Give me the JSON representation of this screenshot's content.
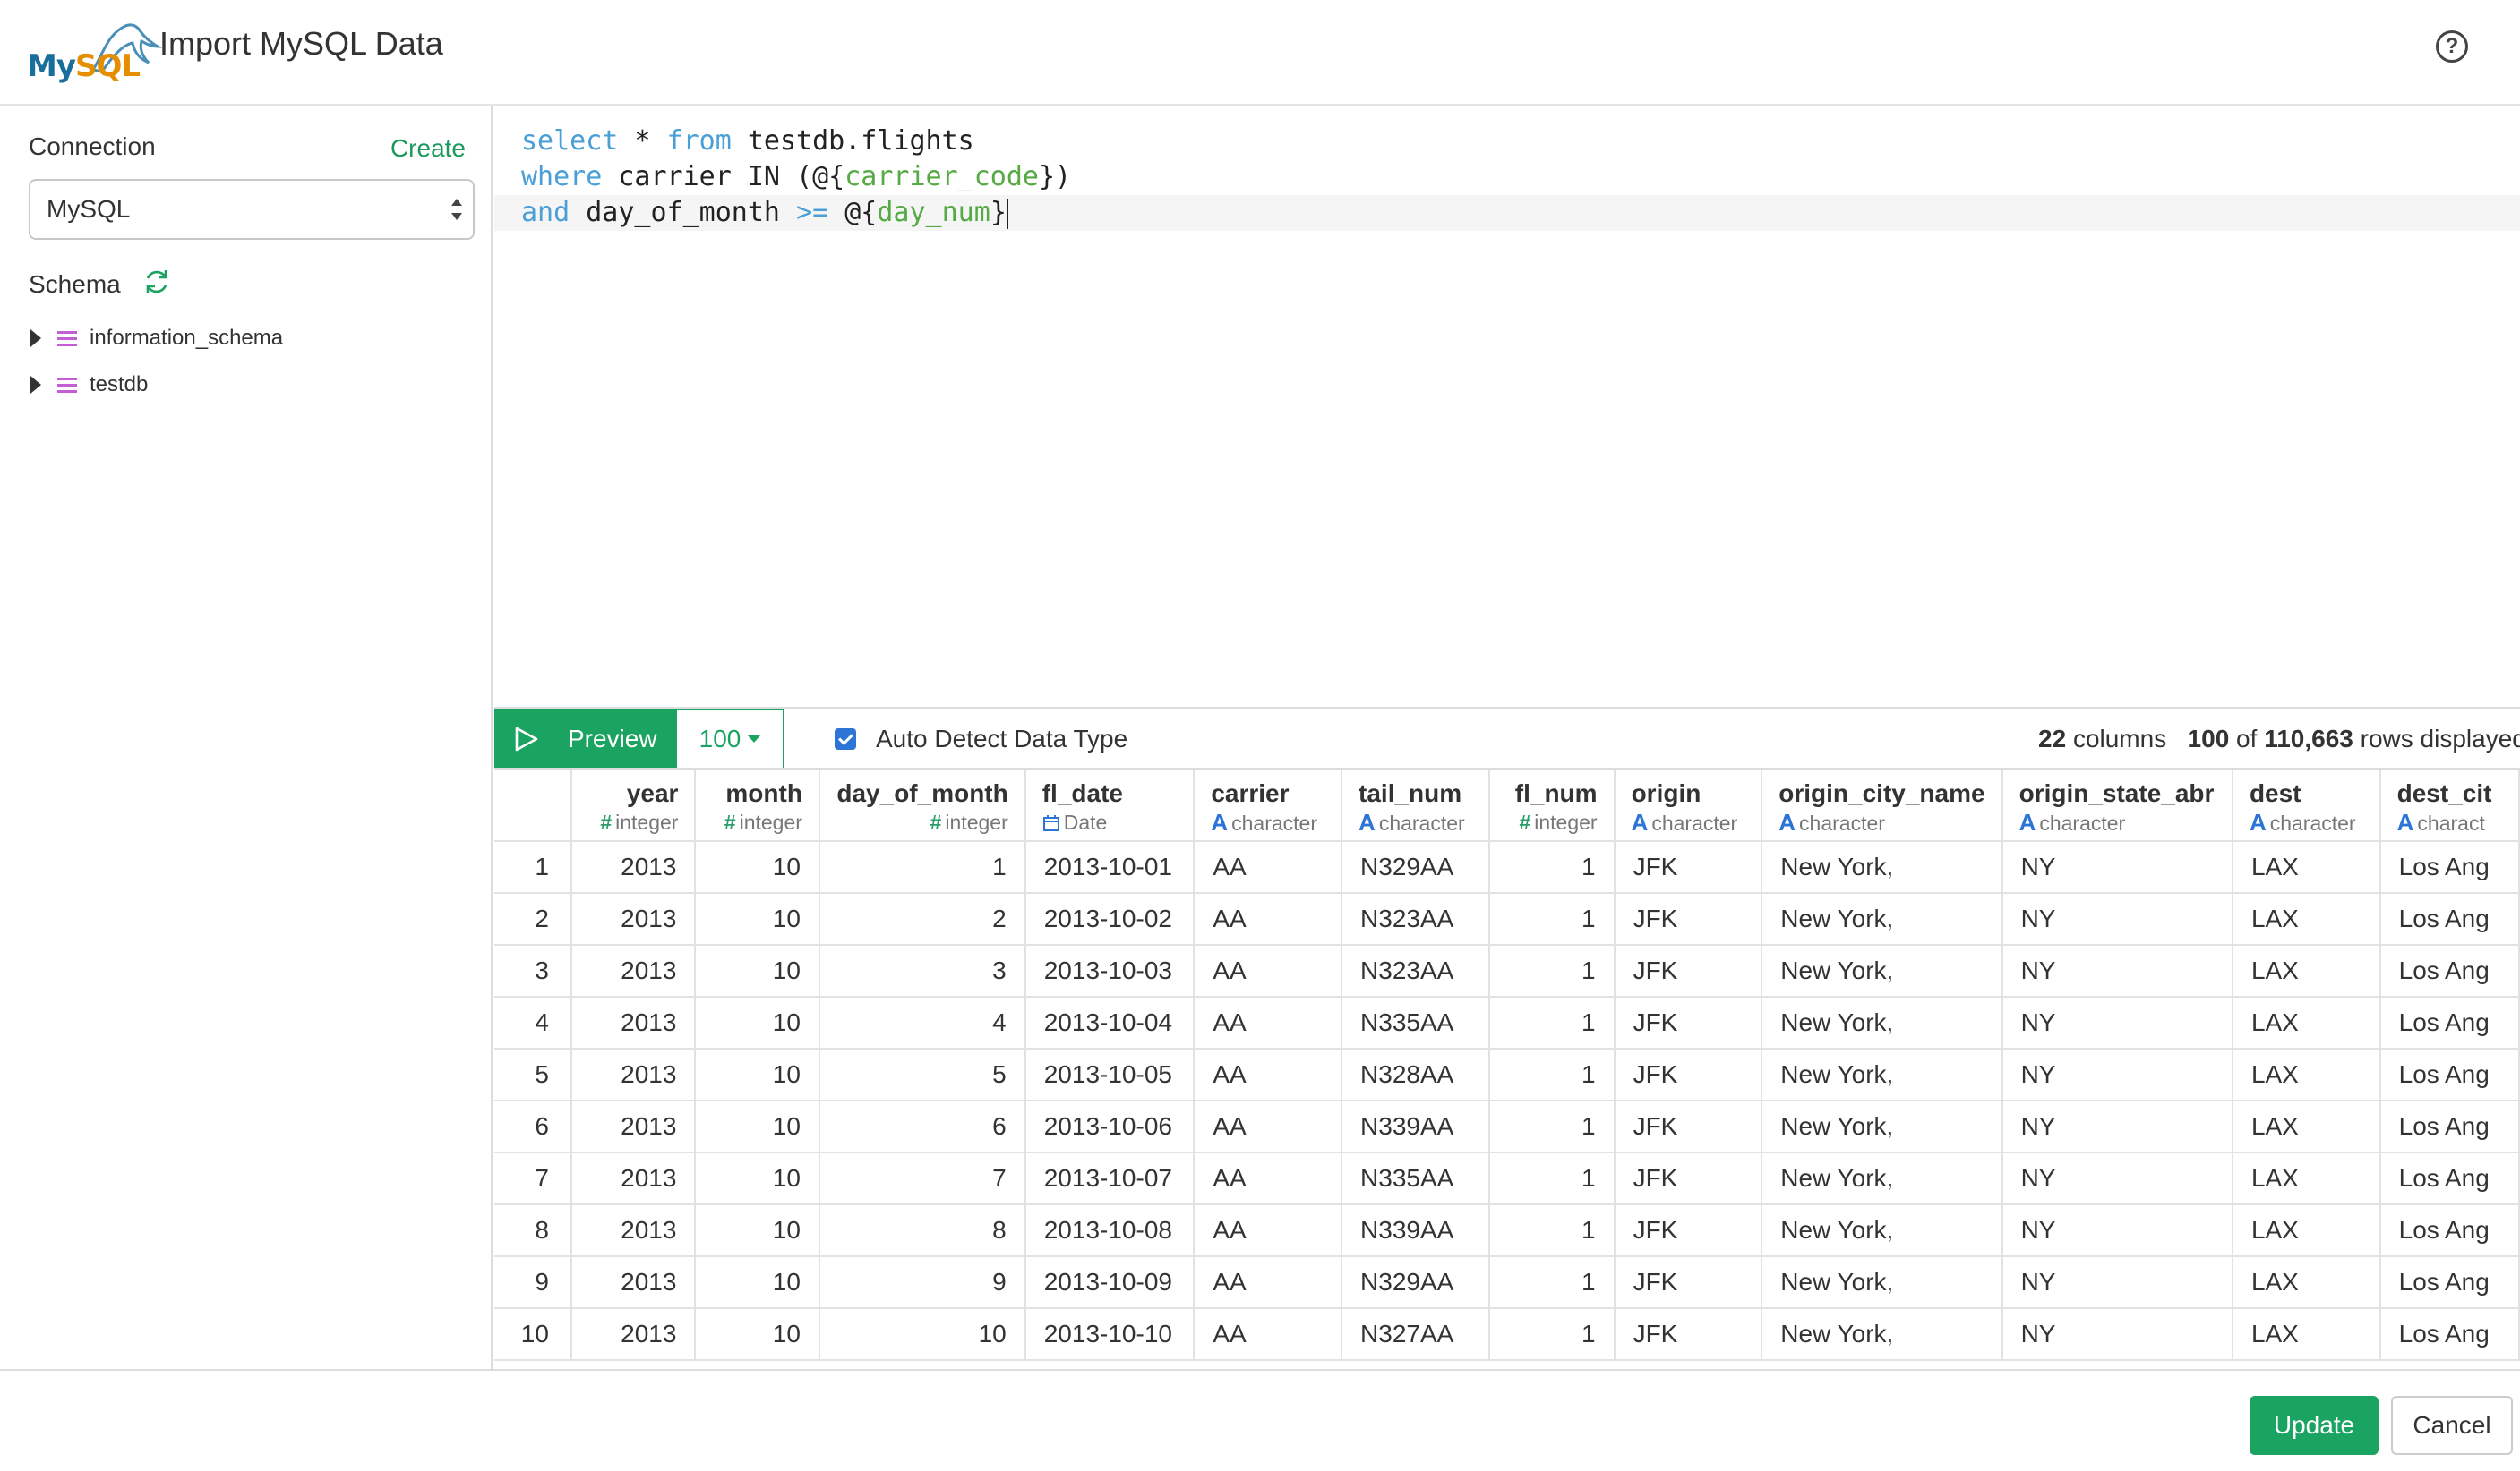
{
  "header": {
    "logo_text_my": "My",
    "logo_text_sql": "SQL",
    "title": "Import MySQL Data",
    "help_icon": "question-circle-icon"
  },
  "sidebar": {
    "connection_label": "Connection",
    "create_label": "Create",
    "connection_value": "MySQL",
    "schema_label": "Schema",
    "schemas": [
      "information_schema",
      "testdb"
    ]
  },
  "editor": {
    "line1": {
      "k1": "select",
      "t1": " * ",
      "k2": "from",
      "t2": " testdb.flights"
    },
    "line2": {
      "k1": "where",
      "t1": " carrier IN (@{",
      "v1": "carrier_code",
      "t2": "})"
    },
    "line3": {
      "k1": "and",
      "t1": " day_of_month ",
      "k2": ">=",
      "t2": " @{",
      "v1": "day_num",
      "t3": "}"
    }
  },
  "toolbar": {
    "preview_label": "Preview",
    "limit_value": "100",
    "auto_detect_label": "Auto Detect Data Type",
    "auto_detect_checked": true,
    "columns_count": "22",
    "columns_word": "columns",
    "rows_shown": "100",
    "of_word": "of",
    "rows_total": "110,663",
    "rows_word": "rows displayed"
  },
  "grid": {
    "columns": [
      {
        "name": "year",
        "type": "integer",
        "icon": "#",
        "kind": "int",
        "align": "num"
      },
      {
        "name": "month",
        "type": "integer",
        "icon": "#",
        "kind": "int",
        "align": "num"
      },
      {
        "name": "day_of_month",
        "type": "integer",
        "icon": "#",
        "kind": "int",
        "align": "num"
      },
      {
        "name": "fl_date",
        "type": "Date",
        "icon": "calendar",
        "kind": "date",
        "align": "txt"
      },
      {
        "name": "carrier",
        "type": "character",
        "icon": "A",
        "kind": "char",
        "align": "txt"
      },
      {
        "name": "tail_num",
        "type": "character",
        "icon": "A",
        "kind": "char",
        "align": "txt"
      },
      {
        "name": "fl_num",
        "type": "integer",
        "icon": "#",
        "kind": "int",
        "align": "num"
      },
      {
        "name": "origin",
        "type": "character",
        "icon": "A",
        "kind": "char",
        "align": "txt"
      },
      {
        "name": "origin_city_name",
        "type": "character",
        "icon": "A",
        "kind": "char",
        "align": "txt"
      },
      {
        "name": "origin_state_abr",
        "type": "character",
        "icon": "A",
        "kind": "char",
        "align": "txt"
      },
      {
        "name": "dest",
        "type": "character",
        "icon": "A",
        "kind": "char",
        "align": "txt"
      },
      {
        "name": "dest_cit",
        "type": "charact",
        "icon": "A",
        "kind": "char",
        "align": "txt"
      }
    ],
    "rows": [
      [
        "1",
        "2013",
        "10",
        "1",
        "2013-10-01",
        "AA",
        "N329AA",
        "1",
        "JFK",
        "New York,",
        "NY",
        "LAX",
        "Los Ang"
      ],
      [
        "2",
        "2013",
        "10",
        "2",
        "2013-10-02",
        "AA",
        "N323AA",
        "1",
        "JFK",
        "New York,",
        "NY",
        "LAX",
        "Los Ang"
      ],
      [
        "3",
        "2013",
        "10",
        "3",
        "2013-10-03",
        "AA",
        "N323AA",
        "1",
        "JFK",
        "New York,",
        "NY",
        "LAX",
        "Los Ang"
      ],
      [
        "4",
        "2013",
        "10",
        "4",
        "2013-10-04",
        "AA",
        "N335AA",
        "1",
        "JFK",
        "New York,",
        "NY",
        "LAX",
        "Los Ang"
      ],
      [
        "5",
        "2013",
        "10",
        "5",
        "2013-10-05",
        "AA",
        "N328AA",
        "1",
        "JFK",
        "New York,",
        "NY",
        "LAX",
        "Los Ang"
      ],
      [
        "6",
        "2013",
        "10",
        "6",
        "2013-10-06",
        "AA",
        "N339AA",
        "1",
        "JFK",
        "New York,",
        "NY",
        "LAX",
        "Los Ang"
      ],
      [
        "7",
        "2013",
        "10",
        "7",
        "2013-10-07",
        "AA",
        "N335AA",
        "1",
        "JFK",
        "New York,",
        "NY",
        "LAX",
        "Los Ang"
      ],
      [
        "8",
        "2013",
        "10",
        "8",
        "2013-10-08",
        "AA",
        "N339AA",
        "1",
        "JFK",
        "New York,",
        "NY",
        "LAX",
        "Los Ang"
      ],
      [
        "9",
        "2013",
        "10",
        "9",
        "2013-10-09",
        "AA",
        "N329AA",
        "1",
        "JFK",
        "New York,",
        "NY",
        "LAX",
        "Los Ang"
      ],
      [
        "10",
        "2013",
        "10",
        "10",
        "2013-10-10",
        "AA",
        "N327AA",
        "1",
        "JFK",
        "New York,",
        "NY",
        "LAX",
        "Los Ang"
      ]
    ]
  },
  "footer": {
    "update_label": "Update",
    "cancel_label": "Cancel"
  },
  "colors": {
    "accent_green": "#1ba461",
    "keyword_blue": "#4a9fd6",
    "variable_green": "#55aa44",
    "schema_icon": "#c45ed4",
    "checkbox_blue": "#2c74d6"
  }
}
